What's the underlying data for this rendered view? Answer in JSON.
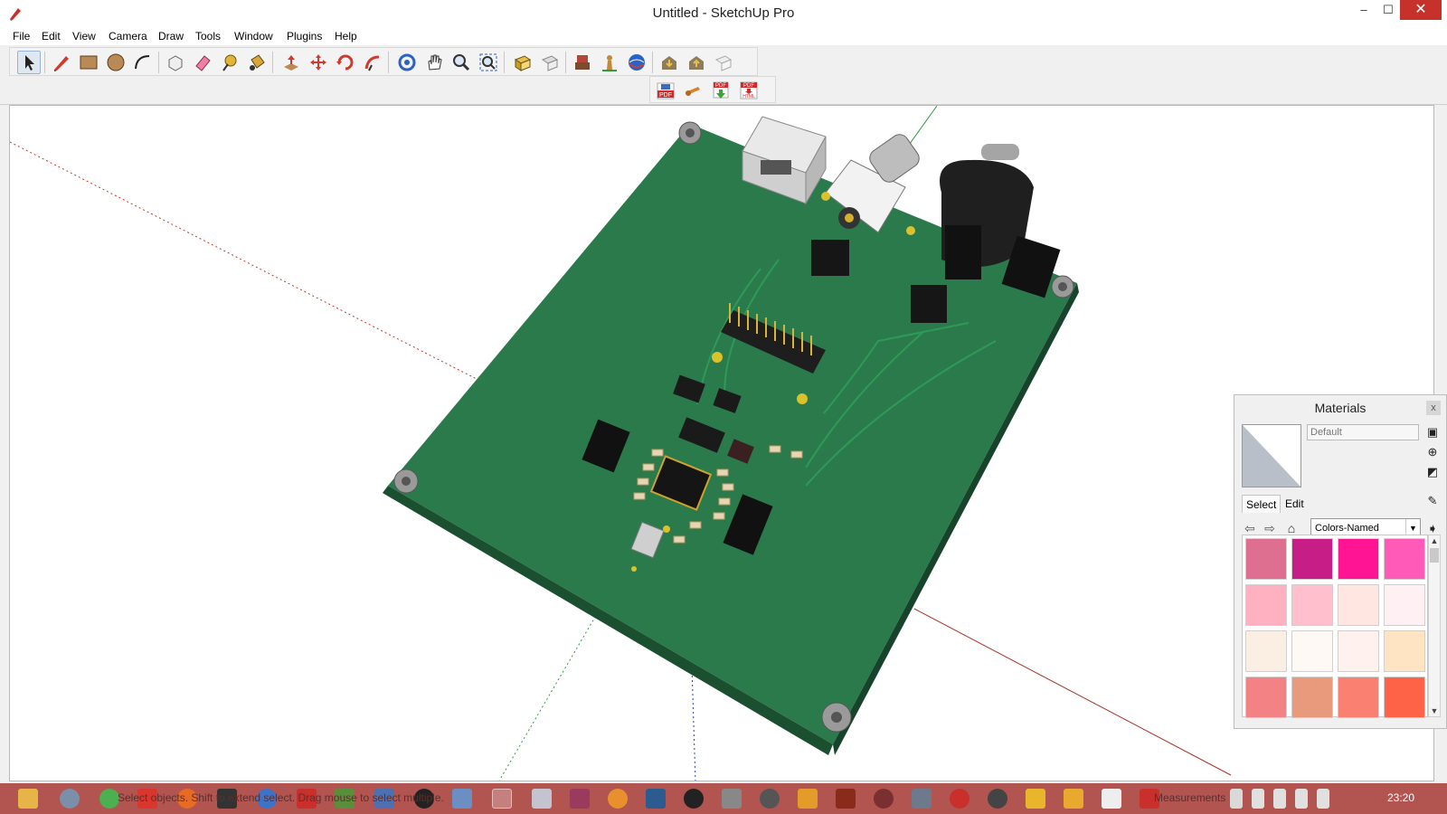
{
  "window": {
    "title": "Untitled - SketchUp Pro",
    "minimize_glyph": "–",
    "maximize_glyph": "☐",
    "close_glyph": "✕"
  },
  "menu": [
    "File",
    "Edit",
    "View",
    "Camera",
    "Draw",
    "Tools",
    "Window",
    "Plugins",
    "Help"
  ],
  "toolbar": {
    "icons": [
      "select-tool-icon",
      "pencil-line-icon",
      "rectangle-icon",
      "circle-icon",
      "arc-icon",
      "make-component-icon",
      "eraser-icon",
      "tape-measure-icon",
      "paint-bucket-icon",
      "push-pull-icon",
      "move-icon",
      "rotate-icon",
      "follow-me-icon",
      "orbit-icon",
      "pan-icon",
      "zoom-icon",
      "zoom-extents-icon",
      "get-models-icon",
      "share-model-icon",
      "components-icon",
      "position-camera-icon",
      "walk-icon",
      "add-location-icon",
      "warehouse-download-icon",
      "upload-icon",
      "section-icon"
    ],
    "plugins": [
      "pdf-export-icon",
      "tool-plugin-icon",
      "pdf-import-icon",
      "pdf-html-icon"
    ],
    "plugin_labels": {
      "pdf": "PDF",
      "html": "HTML"
    }
  },
  "materials": {
    "title": "Materials",
    "close": "x",
    "name_placeholder": "Default",
    "tabs": [
      "Select",
      "Edit"
    ],
    "library": "Colors-Named",
    "swatches": [
      "#de6f91",
      "#c71d86",
      "#ff1493",
      "#ff5ab7",
      "#ffb1c1",
      "#ffbfcd",
      "#ffe6e0",
      "#fff0f3",
      "#fbeee2",
      "#fff9f6",
      "#fff2ee",
      "#ffe4c4",
      "#f28284",
      "#ea9a7c",
      "#fa8072",
      "#ff6347"
    ]
  },
  "status": {
    "hint": "Select objects. Shift to extend select. Drag mouse to select multiple.",
    "measurements_label": "Measurements",
    "time": "23:20"
  },
  "colors": {
    "pcb": "#2b7a4b",
    "pcb_edge": "#1c5533",
    "axis_red": "#c0392b",
    "axis_green": "#2e9c3c",
    "axis_blue": "#2a3fb8",
    "taskbar": "#b25450"
  }
}
